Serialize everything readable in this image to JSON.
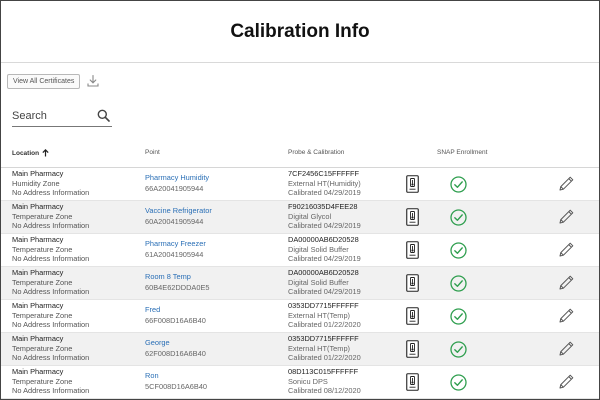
{
  "page": {
    "title": "Calibration Info"
  },
  "toolbar": {
    "view_all_label": "View All Certificates",
    "download_icon": "download-icon"
  },
  "search": {
    "label": "Search",
    "icon": "search-icon"
  },
  "table": {
    "headers": {
      "location": "Location",
      "point": "Point",
      "probe": "Probe & Calibration",
      "snap": "SNAP Enrollment"
    },
    "sort": {
      "column": "location",
      "direction": "ascending"
    },
    "rows": [
      {
        "location": "Main Pharmacy",
        "zone": "Humidity Zone",
        "address": "No Address Information",
        "point_name": "Pharmacy Humidity",
        "point_id": "66A20041905944",
        "probe_id": "7CF2456C15FFFFFF",
        "probe_type": "External HT(Humidity)",
        "calibrated": "Calibrated 04/29/2019",
        "snap_enrolled": true
      },
      {
        "location": "Main Pharmacy",
        "zone": "Temperature Zone",
        "address": "No Address Information",
        "point_name": "Vaccine Refrigerator",
        "point_id": "60A20041905944",
        "probe_id": "F90216035D4FEE28",
        "probe_type": "Digital Glycol",
        "calibrated": "Calibrated 04/29/2019",
        "snap_enrolled": true
      },
      {
        "location": "Main Pharmacy",
        "zone": "Temperature Zone",
        "address": "No Address Information",
        "point_name": "Pharmacy Freezer",
        "point_id": "61A20041905944",
        "probe_id": "DA00000AB6D20528",
        "probe_type": "Digital Solid Buffer",
        "calibrated": "Calibrated 04/29/2019",
        "snap_enrolled": true
      },
      {
        "location": "Main Pharmacy",
        "zone": "Temperature Zone",
        "address": "No Address Information",
        "point_name": "Room 8 Temp",
        "point_id": "60B4E62DDDA0E5",
        "probe_id": "DA00000AB6D20528",
        "probe_type": "Digital Solid Buffer",
        "calibrated": "Calibrated 04/29/2019",
        "snap_enrolled": true
      },
      {
        "location": "Main Pharmacy",
        "zone": "Temperature Zone",
        "address": "No Address Information",
        "point_name": "Fred",
        "point_id": "66F008D16A6B40",
        "probe_id": "0353DD7715FFFFFF",
        "probe_type": "External HT(Temp)",
        "calibrated": "Calibrated 01/22/2020",
        "snap_enrolled": true
      },
      {
        "location": "Main Pharmacy",
        "zone": "Temperature Zone",
        "address": "No Address Information",
        "point_name": "George",
        "point_id": "62F008D16A6B40",
        "probe_id": "0353DD7715FFFFFF",
        "probe_type": "External HT(Temp)",
        "calibrated": "Calibrated 01/22/2020",
        "snap_enrolled": true
      },
      {
        "location": "Main Pharmacy",
        "zone": "Temperature Zone",
        "address": "No Address Information",
        "point_name": "Ron",
        "point_id": "5CF008D16A6B40",
        "probe_id": "08D113C015FFFFFF",
        "probe_type": "Sonicu DPS",
        "calibrated": "Calibrated 08/12/2020",
        "snap_enrolled": true
      }
    ]
  },
  "colors": {
    "link": "#2a6fb6",
    "check": "#2e9e4e",
    "row_alt": "#f1f1f1"
  }
}
